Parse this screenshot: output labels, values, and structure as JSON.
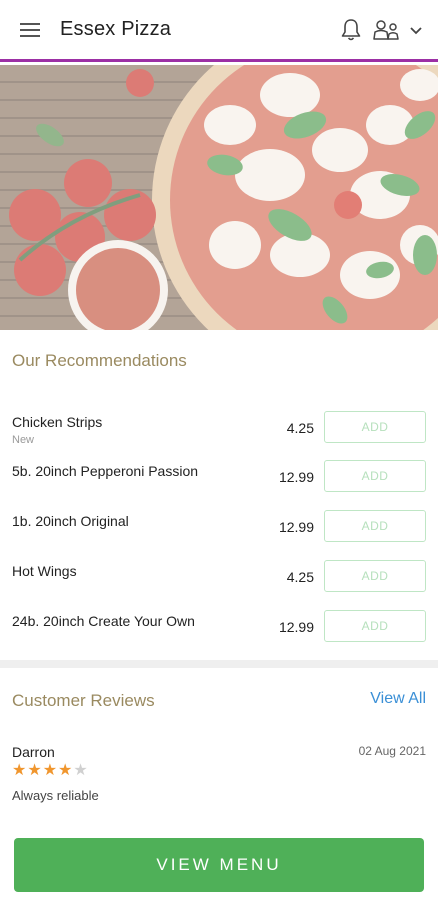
{
  "header": {
    "title": "Essex Pizza",
    "icons": [
      "menu-icon",
      "bell-icon",
      "user-account-icon",
      "chevron-down-icon"
    ],
    "accent_color": "#9c2fa5"
  },
  "recommendations": {
    "title": "Our Recommendations",
    "items": [
      {
        "name": "Chicken Strips",
        "sub": "New",
        "price": "4.25",
        "add_label": "ADD"
      },
      {
        "name": "5b. 20inch Pepperoni Passion",
        "sub": "",
        "price": "12.99",
        "add_label": "ADD"
      },
      {
        "name": "1b. 20inch Original",
        "sub": "",
        "price": "12.99",
        "add_label": "ADD"
      },
      {
        "name": "Hot Wings",
        "sub": "",
        "price": "4.25",
        "add_label": "ADD"
      },
      {
        "name": "24b. 20inch Create Your Own",
        "sub": "",
        "price": "12.99",
        "add_label": "ADD"
      }
    ]
  },
  "reviews": {
    "title": "Customer Reviews",
    "view_all": "View All",
    "items": [
      {
        "name": "Darron",
        "date": "02 Aug 2021",
        "rating": 4,
        "max_rating": 5,
        "text": "Always reliable"
      }
    ]
  },
  "actions": {
    "view_menu": "VIEW MENU",
    "button_color": "#4fb058"
  }
}
